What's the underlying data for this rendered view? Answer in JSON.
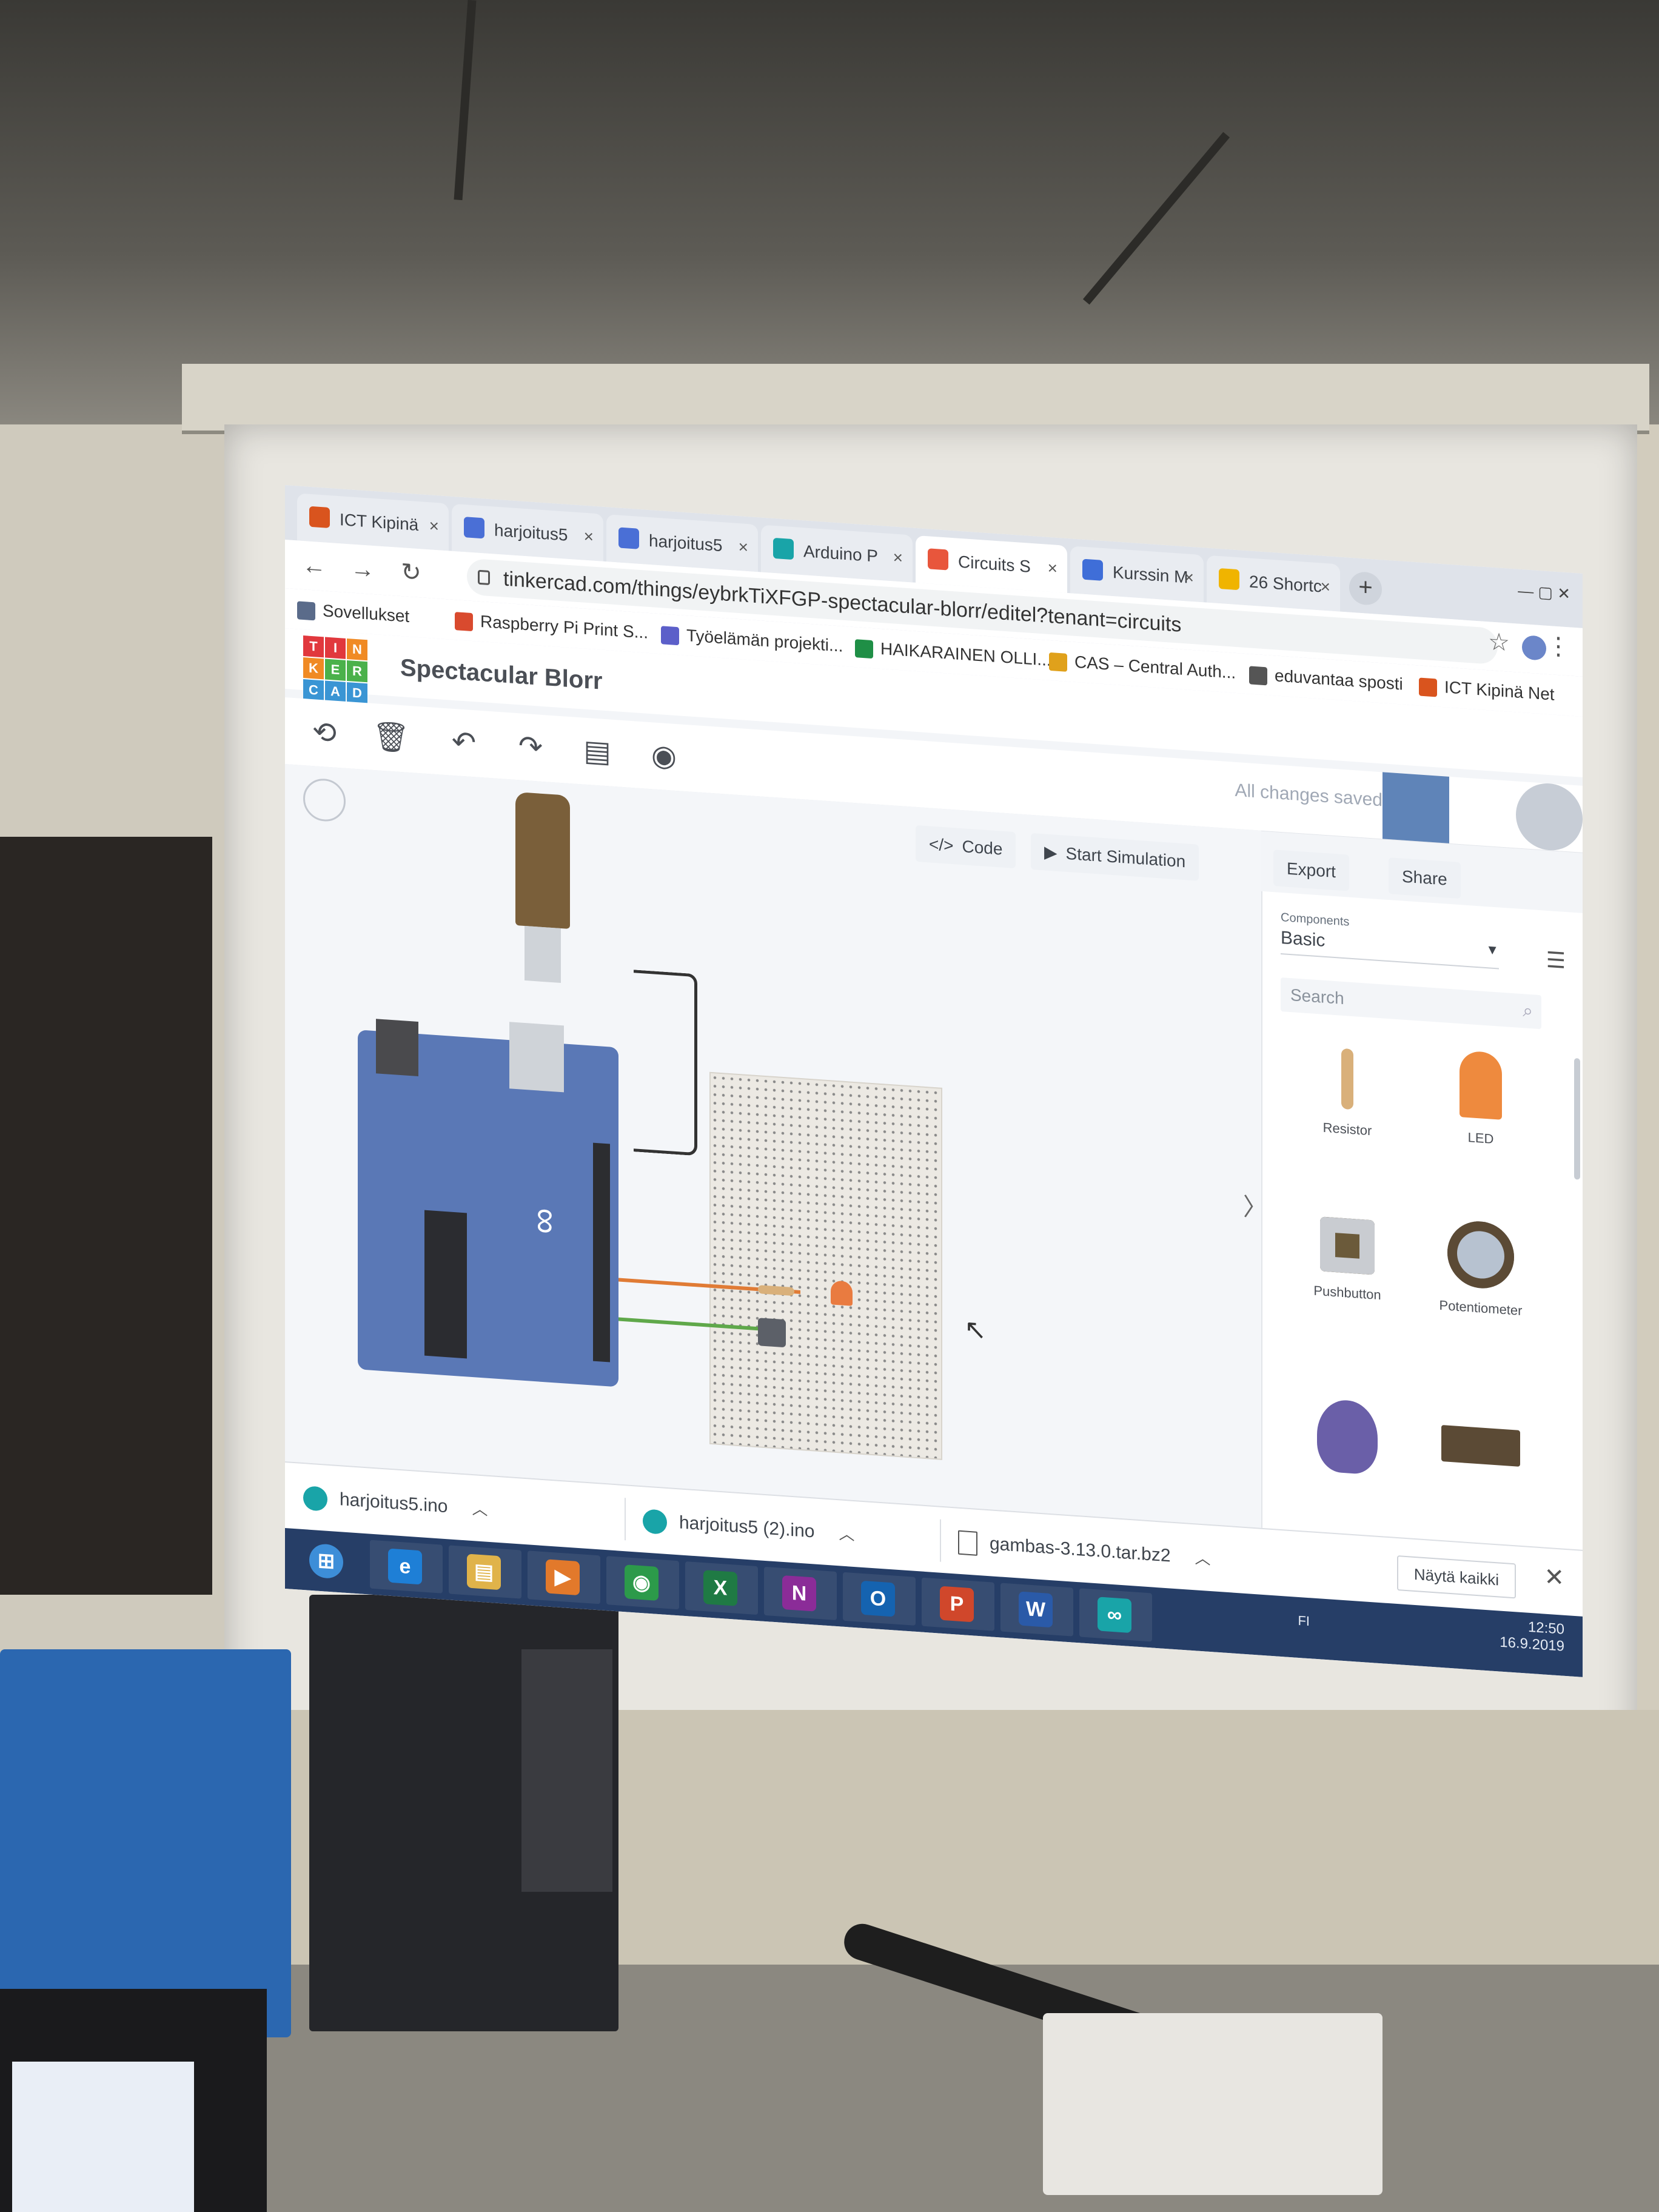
{
  "browser": {
    "tabs": [
      {
        "label": "ICT Kipinä",
        "color": "#d9541e"
      },
      {
        "label": "harjoitus5",
        "color": "#4a6fd6"
      },
      {
        "label": "harjoitus5",
        "color": "#4a6fd6"
      },
      {
        "label": "Arduino P",
        "color": "#19a4a8"
      },
      {
        "label": "Circuits S",
        "color": "#e8563c"
      },
      {
        "label": "Kurssin M",
        "color": "#3f6ed8"
      },
      {
        "label": "26 Shortc",
        "color": "#f0b400"
      }
    ],
    "url": "tinkercad.com/things/eybrkTiXFGP-spectacular-blorr/editel?tenant=circuits",
    "bookmarks": [
      {
        "label": "Sovellukset",
        "color": "#5a6b8a"
      },
      {
        "label": "Raspberry Pi Print S...",
        "color": "#d94a2e"
      },
      {
        "label": "Työelämän projekti...",
        "color": "#5c5fc9"
      },
      {
        "label": "HAIKARAINEN OLLI...",
        "color": "#1f8f46"
      },
      {
        "label": "CAS – Central Auth...",
        "color": "#e0a11b"
      },
      {
        "label": "eduvantaa sposti",
        "color": "#555555"
      },
      {
        "label": "ICT Kipinä Net",
        "color": "#d9541e"
      }
    ]
  },
  "tinkercad": {
    "logo_letters": [
      "T",
      "I",
      "N",
      "K",
      "E",
      "R",
      "C",
      "A",
      "D"
    ],
    "logo_colors": [
      "#e1383d",
      "#e1383d",
      "#f08a24",
      "#f08a24",
      "#4bb14b",
      "#4bb14b",
      "#3a95d4",
      "#3a95d4",
      "#3a95d4"
    ],
    "project_title": "Spectacular Blorr",
    "save_status": "All changes saved",
    "code_label": "Code",
    "start_simulation_label": "Start Simulation",
    "export_label": "Export",
    "share_label": "Share"
  },
  "panel": {
    "category_label": "Components",
    "category_value": "Basic",
    "search_placeholder": "Search",
    "components": [
      "Resistor",
      "LED",
      "Pushbutton",
      "Potentiometer"
    ]
  },
  "downloads": {
    "items": [
      "harjoitus5.ino",
      "harjoitus5 (2).ino",
      "gambas-3.13.0.tar.bz2"
    ],
    "show_all_label": "Näytä kaikki"
  },
  "taskbar": {
    "apps": [
      {
        "name": "ie",
        "glyph": "e",
        "color": "#1e7fd6"
      },
      {
        "name": "explorer",
        "glyph": "▤",
        "color": "#e0b34a"
      },
      {
        "name": "media",
        "glyph": "▶",
        "color": "#e2792b"
      },
      {
        "name": "chrome",
        "glyph": "◉",
        "color": "#2c9a4a"
      },
      {
        "name": "excel",
        "glyph": "X",
        "color": "#1f7a44"
      },
      {
        "name": "onenote",
        "glyph": "N",
        "color": "#8b2c98"
      },
      {
        "name": "outlook",
        "glyph": "O",
        "color": "#1563b0"
      },
      {
        "name": "powerpoint",
        "glyph": "P",
        "color": "#d0472b"
      },
      {
        "name": "word",
        "glyph": "W",
        "color": "#2a5aa8"
      },
      {
        "name": "arduino",
        "glyph": "∞",
        "color": "#19a4a8"
      }
    ],
    "lang": "FI",
    "time": "12:50",
    "date": "16.9.2019"
  }
}
